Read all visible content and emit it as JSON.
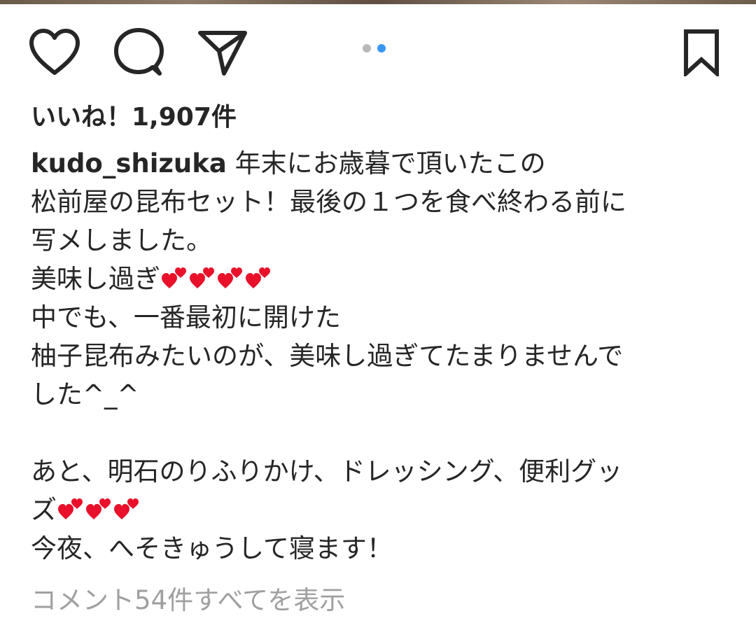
{
  "post": {
    "likes_text": "いいね！1,907件",
    "username": "kudo_shizuka",
    "caption_line1": " 年末にお歳暮で頂いたこの",
    "caption_line2": "松前屋の昆布セット！最後の１つを食べ終わる前に",
    "caption_line3": "写メしました。",
    "caption_line4": "美味し過ぎ",
    "caption_line5": "中でも、一番最初に開けた",
    "caption_line6": "柚子昆布みたいのが、美味し過ぎてたまりませんで",
    "caption_line7": "した^_^",
    "caption_line8": "",
    "caption_line9": "あと、明石のりふりかけ、ドレッシング、便利グッ",
    "caption_line10": "ズ",
    "caption_line11": "今夜、へそきゅうして寝ます！",
    "view_comments": "コメント54件すべてを表示"
  },
  "icons": {
    "like": "heart-outline-icon",
    "comment": "comment-bubble-icon",
    "share": "paper-plane-icon",
    "save": "bookmark-icon",
    "emoji": "two-hearts-emoji"
  },
  "carousel": {
    "count": 2,
    "active_index": 1
  },
  "colors": {
    "text": "#262626",
    "secondary": "#a0a0a0",
    "dot_active": "#3897f0",
    "dot_inactive": "#b9b9b9",
    "heart": "#e8102a"
  }
}
